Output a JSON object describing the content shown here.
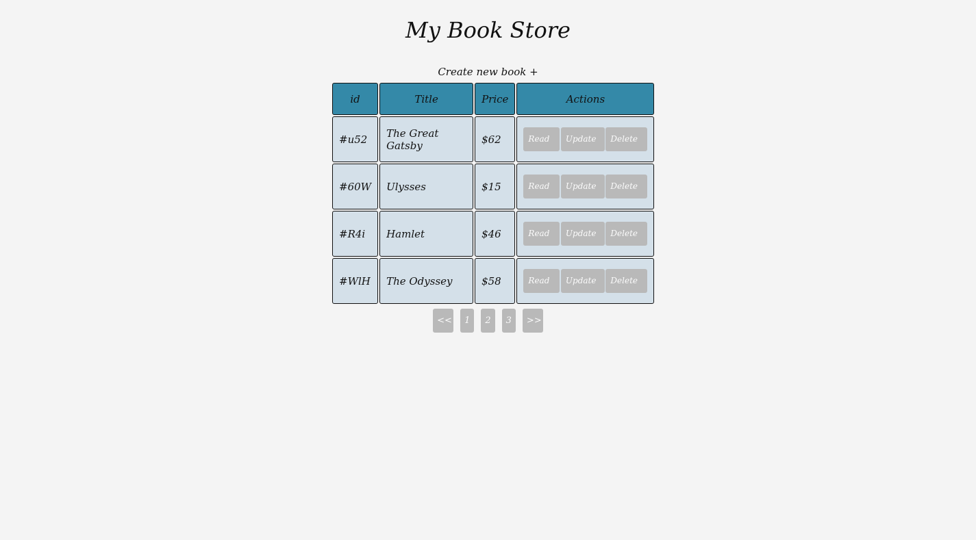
{
  "header": {
    "title": "My Book Store",
    "create_link": "Create new book +"
  },
  "table": {
    "columns": [
      "id",
      "Title",
      "Price",
      "Actions"
    ],
    "rows": [
      {
        "id": "#u52",
        "title": "The Great Gatsby",
        "price": "$62"
      },
      {
        "id": "#60W",
        "title": "Ulysses",
        "price": "$15"
      },
      {
        "id": "#R4i",
        "title": "Hamlet",
        "price": "$46"
      },
      {
        "id": "#WlH",
        "title": "The Odyssey",
        "price": "$58"
      }
    ],
    "actions": {
      "read": "Read",
      "update": "Update",
      "delete": "Delete"
    }
  },
  "pagination": {
    "prev": "<<",
    "pages": [
      "1",
      "2",
      "3"
    ],
    "next": ">>"
  },
  "colors": {
    "background": "#f4f4f4",
    "header_cell": "#3489a8",
    "body_cell": "#d4e0e9",
    "button": "#b9b9b9",
    "button_text": "#fbfbfb"
  }
}
